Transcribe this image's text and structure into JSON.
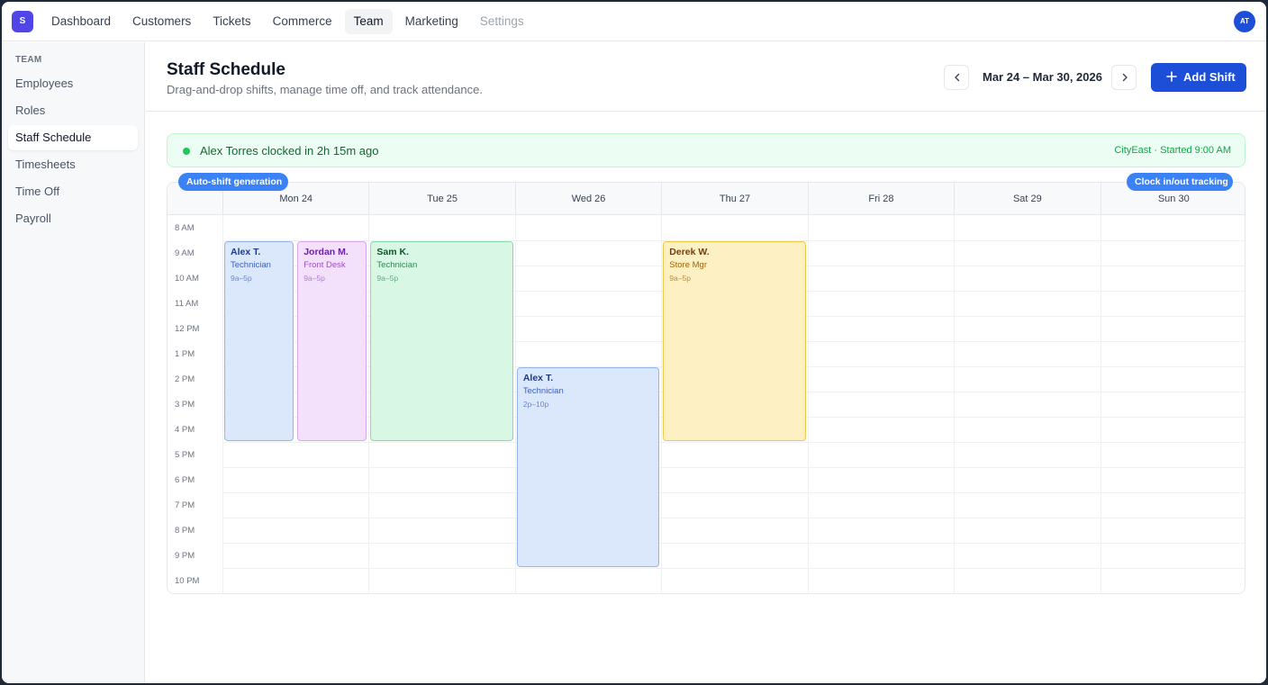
{
  "app": {
    "logo": "S",
    "avatar": "AT"
  },
  "nav": {
    "items": [
      {
        "label": "Dashboard"
      },
      {
        "label": "Customers"
      },
      {
        "label": "Tickets"
      },
      {
        "label": "Commerce"
      },
      {
        "label": "Team"
      },
      {
        "label": "Marketing"
      },
      {
        "label": "Settings"
      }
    ],
    "active": "Team"
  },
  "sidebar": {
    "heading": "TEAM",
    "items": [
      {
        "label": "Employees"
      },
      {
        "label": "Roles"
      },
      {
        "label": "Staff Schedule"
      },
      {
        "label": "Timesheets"
      },
      {
        "label": "Time Off"
      },
      {
        "label": "Payroll"
      }
    ],
    "active": "Staff Schedule"
  },
  "header": {
    "title": "Staff Schedule",
    "subtitle": "Drag-and-drop shifts, manage time off, and track attendance.",
    "date_range": "Mar 24 – Mar 30, 2026",
    "add_label": "Add Shift"
  },
  "banner": {
    "text": "Alex Torres clocked in 2h 15m ago",
    "meta": "CityEast · Started 9:00 AM"
  },
  "tags": {
    "left": "Auto-shift generation",
    "right": "Clock in/out tracking"
  },
  "calendar": {
    "days": [
      "Mon 24",
      "Tue 25",
      "Wed 26",
      "Thu 27",
      "Fri 28",
      "Sat 29",
      "Sun 30"
    ],
    "hours": [
      "8 AM",
      "9 AM",
      "10 AM",
      "11 AM",
      "12 PM",
      "1 PM",
      "2 PM",
      "3 PM",
      "4 PM",
      "5 PM",
      "6 PM",
      "7 PM",
      "8 PM",
      "9 PM",
      "10 PM"
    ],
    "shifts": [
      {
        "name": "Alex T.",
        "role": "Technician",
        "time": "9a–5p",
        "day": 0,
        "lane": 0,
        "lanes": 2,
        "start": 9,
        "end": 17,
        "color": "blue"
      },
      {
        "name": "Jordan M.",
        "role": "Front Desk",
        "time": "9a–5p",
        "day": 0,
        "lane": 1,
        "lanes": 2,
        "start": 9,
        "end": 17,
        "color": "purple"
      },
      {
        "name": "Sam K.",
        "role": "Technician",
        "time": "9a–5p",
        "day": 1,
        "lane": 0,
        "lanes": 1,
        "start": 9,
        "end": 17,
        "color": "green"
      },
      {
        "name": "Alex T.",
        "role": "Technician",
        "time": "2p–10p",
        "day": 2,
        "lane": 0,
        "lanes": 1,
        "start": 14,
        "end": 22,
        "color": "blue"
      },
      {
        "name": "Derek W.",
        "role": "Store Mgr",
        "time": "9a–5p",
        "day": 3,
        "lane": 0,
        "lanes": 1,
        "start": 9,
        "end": 17,
        "color": "yellow"
      }
    ]
  }
}
